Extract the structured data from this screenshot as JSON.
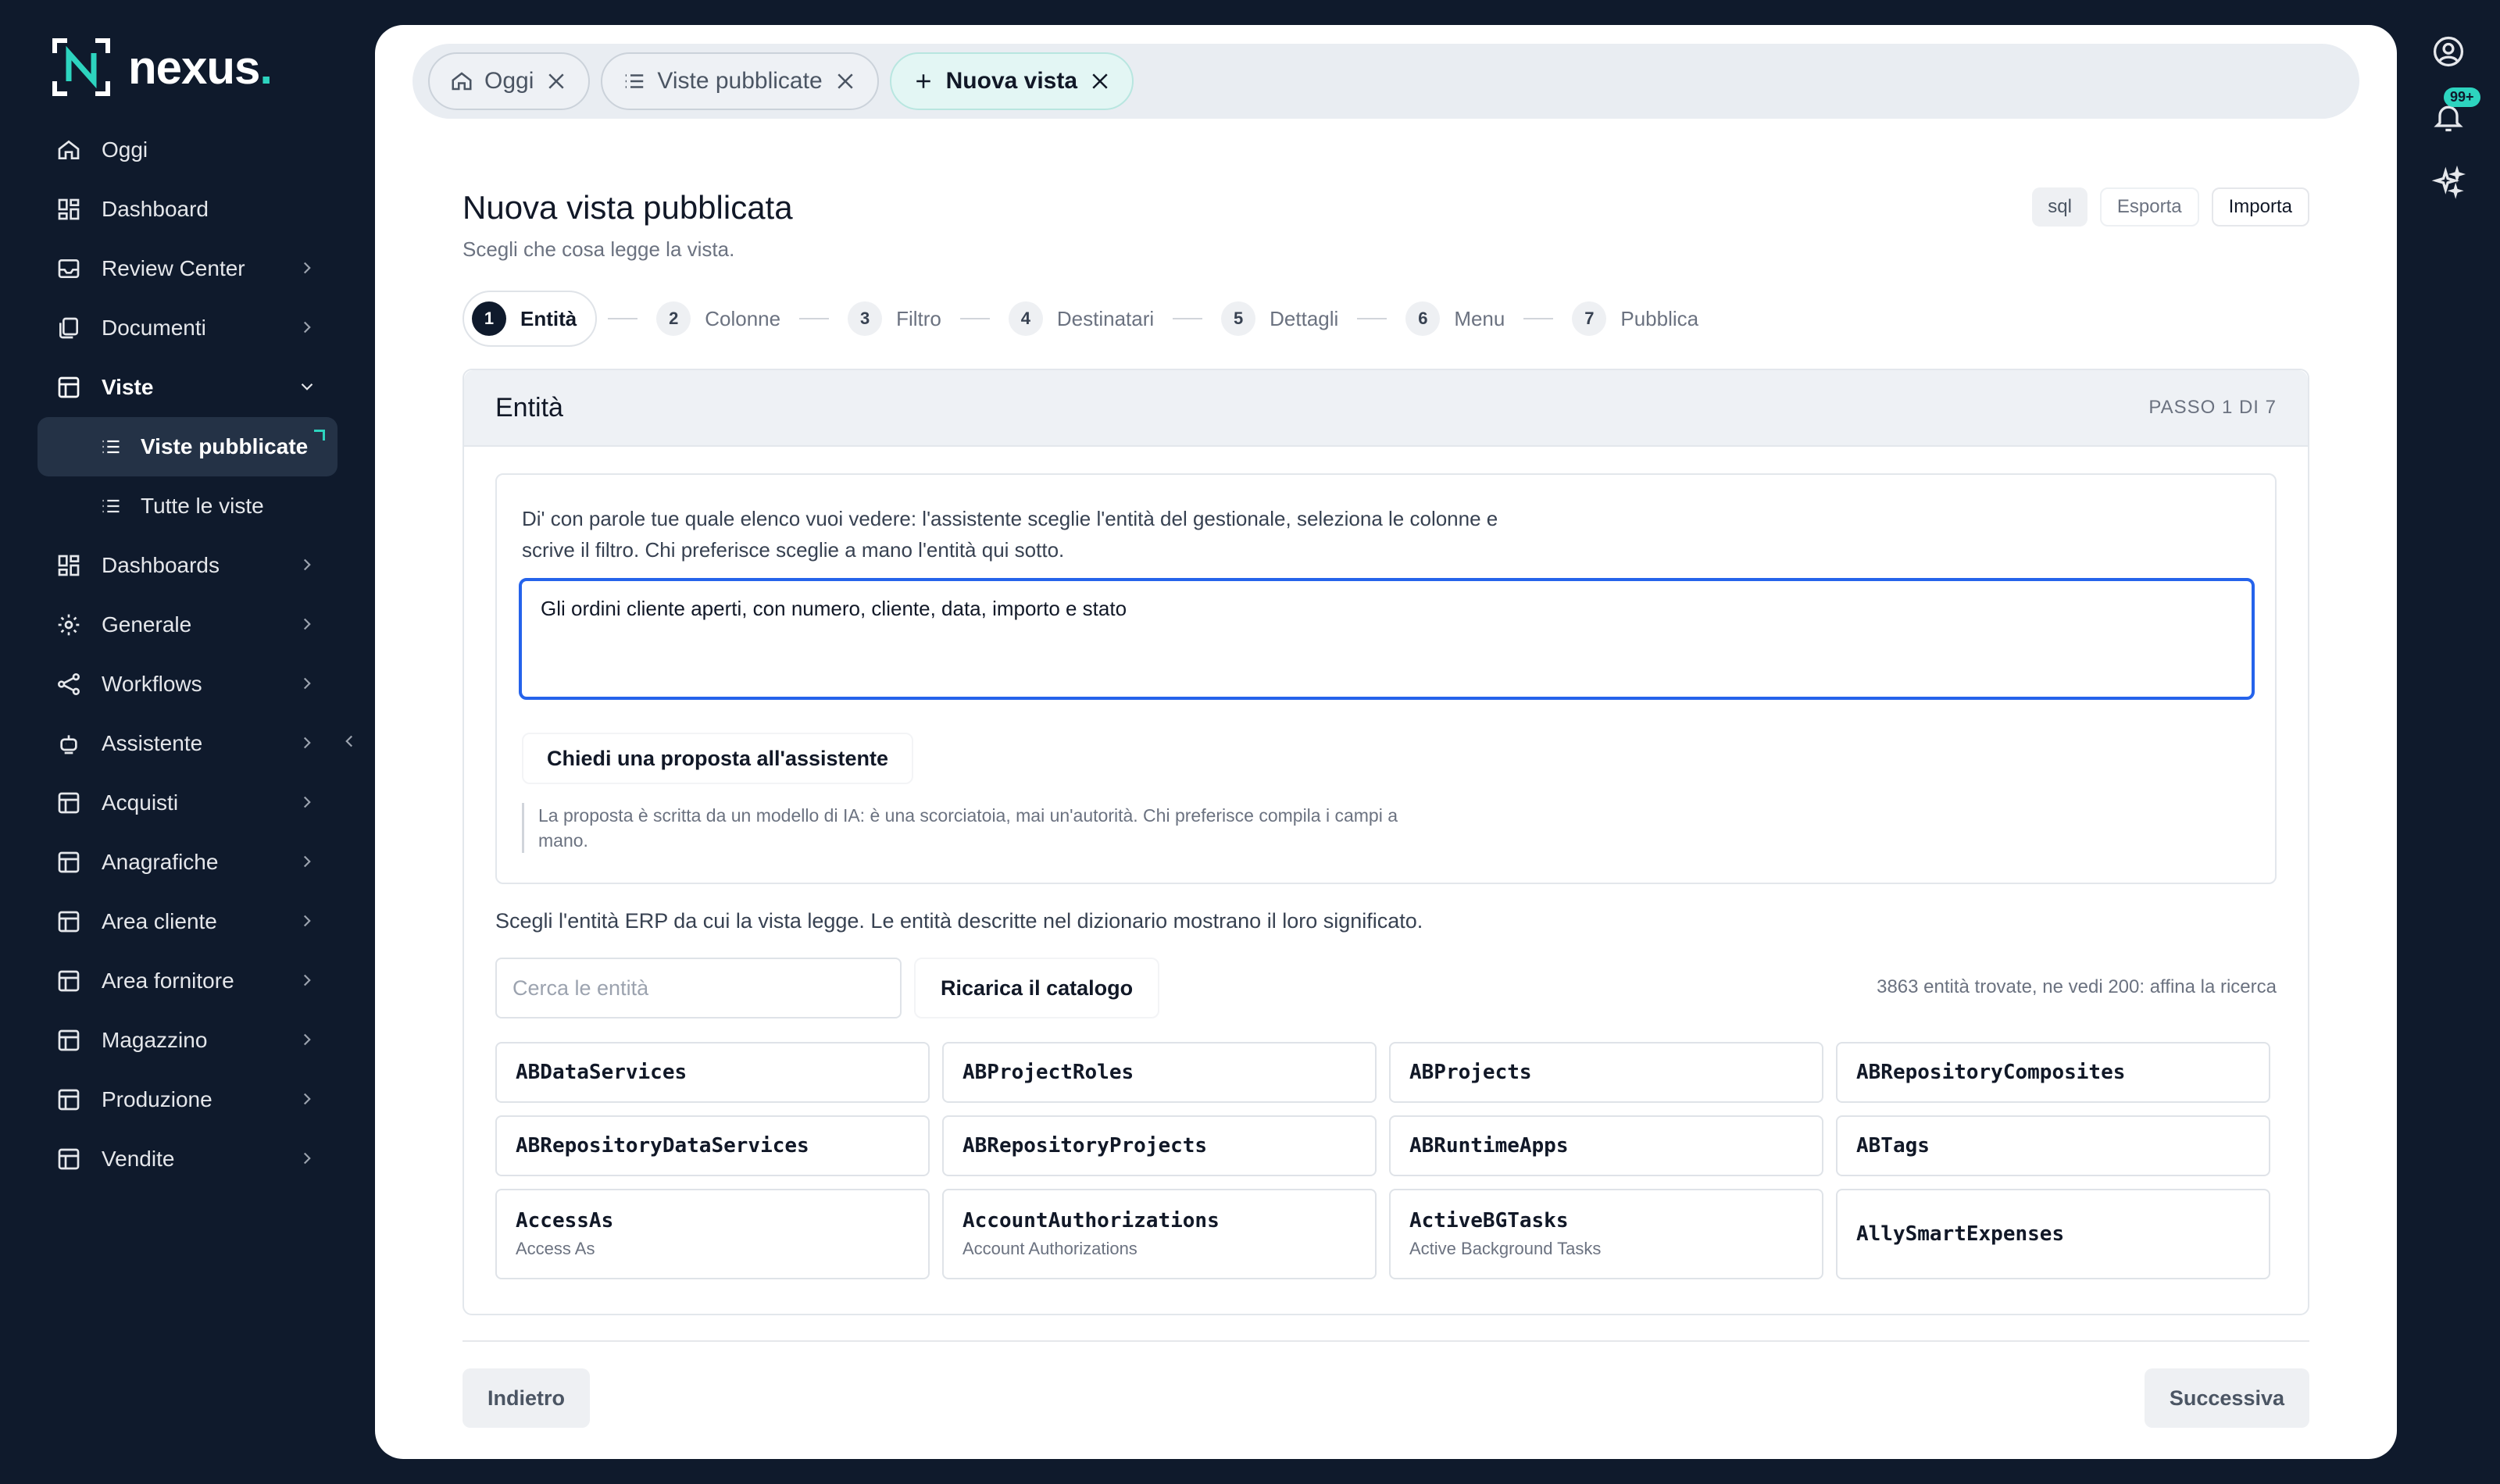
{
  "app": {
    "brand": "nexus",
    "brand_dot": "."
  },
  "sidebar": {
    "items": [
      {
        "label": "Oggi",
        "icon": "home-icon"
      },
      {
        "label": "Dashboard",
        "icon": "dashboard-icon"
      },
      {
        "label": "Review Center",
        "icon": "inbox-icon"
      },
      {
        "label": "Documenti",
        "icon": "documents-icon"
      },
      {
        "label": "Viste",
        "icon": "table-icon"
      },
      {
        "label": "Viste pubblicate",
        "icon": "list-icon"
      },
      {
        "label": "Tutte le viste",
        "icon": "list-icon"
      },
      {
        "label": "Dashboards",
        "icon": "dashboard-icon"
      },
      {
        "label": "Generale",
        "icon": "gear-icon"
      },
      {
        "label": "Workflows",
        "icon": "share-icon"
      },
      {
        "label": "Assistente",
        "icon": "bot-icon"
      },
      {
        "label": "Acquisti",
        "icon": "table-icon"
      },
      {
        "label": "Anagrafiche",
        "icon": "table-icon"
      },
      {
        "label": "Area cliente",
        "icon": "table-icon"
      },
      {
        "label": "Area fornitore",
        "icon": "table-icon"
      },
      {
        "label": "Magazzino",
        "icon": "table-icon"
      },
      {
        "label": "Produzione",
        "icon": "table-icon"
      },
      {
        "label": "Vendite",
        "icon": "table-icon"
      }
    ]
  },
  "rail": {
    "notifications_badge": "99+"
  },
  "tabs": [
    {
      "label": "Oggi",
      "icon": "home-icon"
    },
    {
      "label": "Viste pubblicate",
      "icon": "list-icon"
    },
    {
      "label": "Nuova vista",
      "icon": "plus-icon"
    }
  ],
  "page": {
    "title": "Nuova vista pubblicata",
    "subtitle": "Scegli che cosa legge la vista.",
    "actions": {
      "sql": "sql",
      "export": "Esporta",
      "import": "Importa"
    }
  },
  "steps": [
    {
      "num": "1",
      "label": "Entità"
    },
    {
      "num": "2",
      "label": "Colonne"
    },
    {
      "num": "3",
      "label": "Filtro"
    },
    {
      "num": "4",
      "label": "Destinatari"
    },
    {
      "num": "5",
      "label": "Dettagli"
    },
    {
      "num": "6",
      "label": "Menu"
    },
    {
      "num": "7",
      "label": "Pubblica"
    }
  ],
  "card": {
    "title": "Entità",
    "step_indicator": "PASSO 1 DI 7",
    "assistant": {
      "intro": "Di' con parole tue quale elenco vuoi vedere: l'assistente sceglie l'entità del gestionale, seleziona le colonne e scrive il filtro. Chi preferisce sceglie a mano l'entità qui sotto.",
      "prompt_value": "Gli ordini cliente aperti, con numero, cliente, data, importo e stato",
      "ask_label": "Chiedi una proposta all'assistente",
      "disclaimer": "La proposta è scritta da un modello di IA: è una scorciatoia, mai un'autorità. Chi preferisce compila i campi a mano."
    },
    "entity_intro": "Scegli l'entità ERP da cui la vista legge. Le entità descritte nel dizionario mostrano il loro significato.",
    "search_placeholder": "Cerca le entità",
    "reload_label": "Ricarica il catalogo",
    "count_text": "3863 entità trovate, ne vedi 200: affina la ricerca",
    "entities": [
      {
        "name": "ABDataServices",
        "desc": ""
      },
      {
        "name": "ABProjectRoles",
        "desc": ""
      },
      {
        "name": "ABProjects",
        "desc": ""
      },
      {
        "name": "ABRepositoryComposites",
        "desc": ""
      },
      {
        "name": "ABRepositoryDataServices",
        "desc": ""
      },
      {
        "name": "ABRepositoryProjects",
        "desc": ""
      },
      {
        "name": "ABRuntimeApps",
        "desc": ""
      },
      {
        "name": "ABTags",
        "desc": ""
      },
      {
        "name": "AccessAs",
        "desc": "Access As"
      },
      {
        "name": "AccountAuthorizations",
        "desc": "Account Authorizations"
      },
      {
        "name": "ActiveBGTasks",
        "desc": "Active Background Tasks"
      },
      {
        "name": "AllySmartExpenses",
        "desc": ""
      }
    ]
  },
  "footer": {
    "back_label": "Indietro",
    "next_label": "Successiva"
  },
  "colors": {
    "accent": "#2dd4bf",
    "sidebar_bg": "#0f1a2c",
    "focus": "#2563eb"
  }
}
